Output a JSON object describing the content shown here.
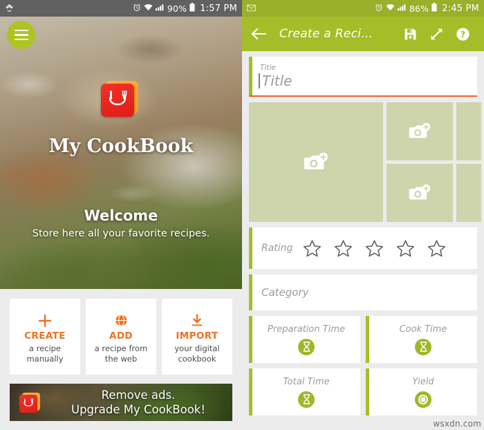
{
  "left_screen": {
    "statusbar": {
      "app_icon": "dropbox-icon",
      "alarm_icon": "alarm-icon",
      "wifi_icon": "wifi-icon",
      "signal_icon": "signal-icon",
      "battery_pct": "90%",
      "battery_icon": "battery-icon",
      "time": "1:57 PM"
    },
    "menu_button": "menu-icon",
    "app_title": "My CookBook",
    "welcome_title": "Welcome",
    "welcome_subtitle": "Store here all your favorite recipes.",
    "actions": [
      {
        "icon": "plus-icon",
        "title": "CREATE",
        "desc_line1": "a recipe",
        "desc_line2": "manually"
      },
      {
        "icon": "globe-icon",
        "title": "ADD",
        "desc_line1": "a recipe from",
        "desc_line2": "the web"
      },
      {
        "icon": "download-icon",
        "title": "IMPORT",
        "desc_line1": "your digital",
        "desc_line2": "cookbook"
      }
    ],
    "ad": {
      "line1": "Remove ads.",
      "line2": "Upgrade My CookBook!",
      "logo": "cookbook-logo-icon"
    }
  },
  "right_screen": {
    "statusbar": {
      "app_icon": "mail-icon",
      "alarm_icon": "alarm-icon",
      "wifi_icon": "wifi-icon",
      "signal_icon": "signal-icon",
      "battery_pct": "86%",
      "battery_icon": "battery-icon",
      "time": "2:45 PM"
    },
    "appbar": {
      "back_icon": "back-arrow-icon",
      "title": "Create a Reci...",
      "save_icon": "save-icon",
      "expand_icon": "expand-icon",
      "help_icon": "help-icon"
    },
    "fields": {
      "title_label": "Title",
      "title_placeholder": "Title",
      "photo_add_icon": "camera-add-icon",
      "rating_label": "Rating",
      "rating_stars": 5,
      "rating_value": 0,
      "category_placeholder": "Category",
      "preparation_time_label": "Preparation Time",
      "cook_time_label": "Cook Time",
      "total_time_label": "Total Time",
      "yield_label": "Yield",
      "hourglass_icon": "hourglass-icon",
      "yield_icon": "bowl-icon"
    }
  },
  "watermark": "wsxdn.com",
  "colors": {
    "green_accent": "#a4bd28",
    "green_statusbar": "#9aaf2a",
    "orange_accent": "#ee7124",
    "orange_underline": "#e8622a",
    "photo_tile": "#ced4ac",
    "page_bg": "#ececec",
    "dark_statusbar": "#616161"
  }
}
